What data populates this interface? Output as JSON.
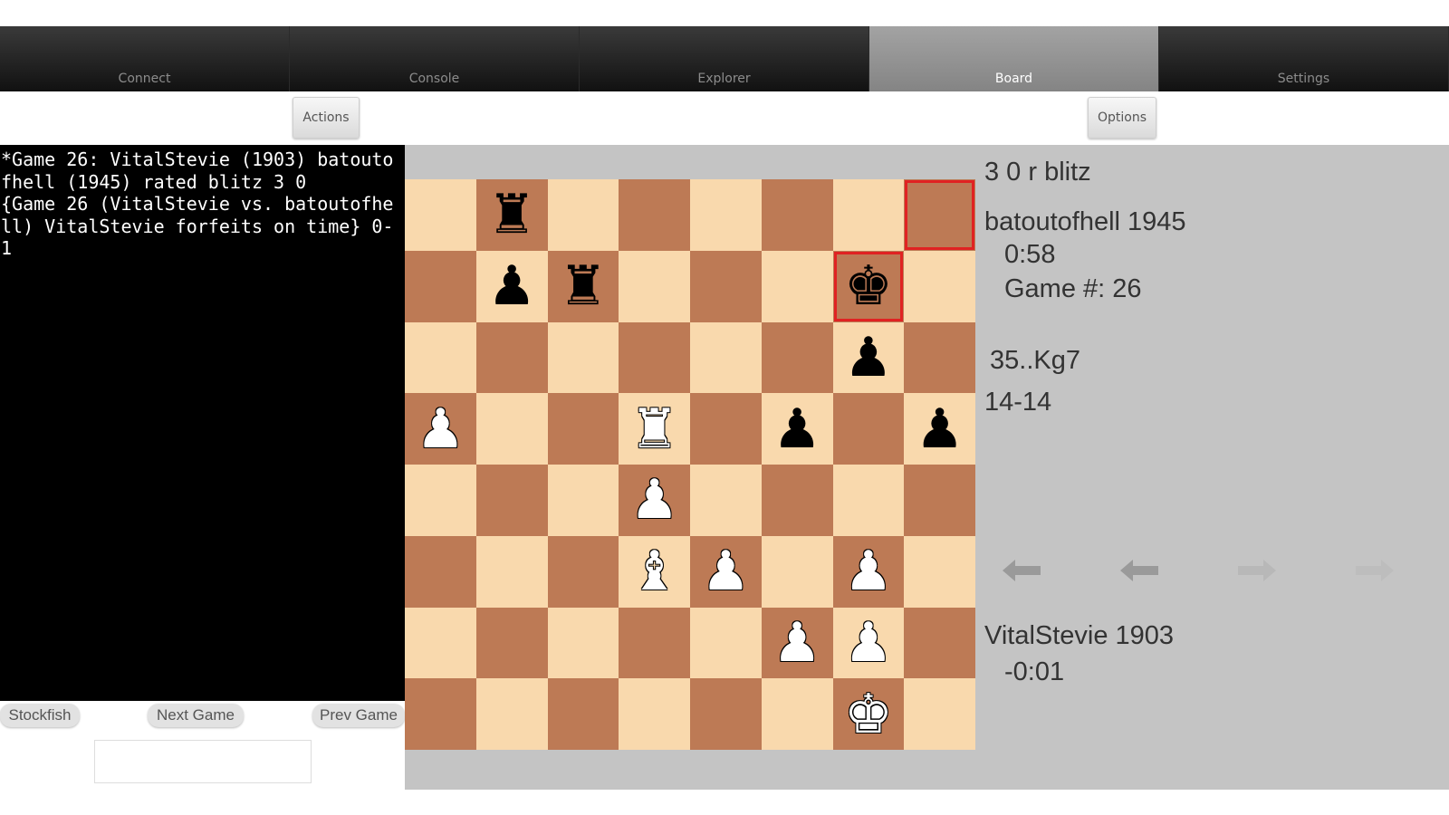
{
  "tabs": [
    {
      "label": "Connect",
      "active": false
    },
    {
      "label": "Console",
      "active": false
    },
    {
      "label": "Explorer",
      "active": false
    },
    {
      "label": "Board",
      "active": true
    },
    {
      "label": "Settings",
      "active": false
    }
  ],
  "toolbar": {
    "actions_label": "Actions",
    "options_label": "Options"
  },
  "console": {
    "text": "*Game 26: VitalStevie (1903) batoutofhell (1945) rated blitz 3 0\n{Game 26 (VitalStevie vs. batoutofhell) VitalStevie forfeits on time} 0-1"
  },
  "console_buttons": {
    "stockfish": "Stockfish",
    "next_game": "Next Game",
    "prev_game": "Prev Game"
  },
  "command_input": {
    "value": "",
    "placeholder": ""
  },
  "game": {
    "type": "3 0 r blitz",
    "top_player": "batoutofhell 1945",
    "top_clock": "0:58",
    "game_number": "Game #: 26",
    "last_move": "35..Kg7",
    "material": "14-14",
    "bottom_player": "VitalStevie 1903",
    "bottom_clock": "-0:01"
  },
  "board": {
    "orientation": "white",
    "light_color": "#f9d9ad",
    "dark_color": "#bd7a55",
    "highlight_color": "#e02222",
    "highlighted_squares": [
      "h8",
      "g7"
    ],
    "pieces": [
      {
        "square": "b8",
        "piece": "rook",
        "color": "black"
      },
      {
        "square": "b7",
        "piece": "pawn",
        "color": "black"
      },
      {
        "square": "c7",
        "piece": "rook",
        "color": "black"
      },
      {
        "square": "g7",
        "piece": "king",
        "color": "black"
      },
      {
        "square": "g6",
        "piece": "pawn",
        "color": "black"
      },
      {
        "square": "a5",
        "piece": "pawn",
        "color": "white"
      },
      {
        "square": "d5",
        "piece": "rook",
        "color": "white"
      },
      {
        "square": "f5",
        "piece": "pawn",
        "color": "black"
      },
      {
        "square": "h5",
        "piece": "pawn",
        "color": "black"
      },
      {
        "square": "d4",
        "piece": "pawn",
        "color": "white"
      },
      {
        "square": "d3",
        "piece": "bishop",
        "color": "white"
      },
      {
        "square": "e3",
        "piece": "pawn",
        "color": "white"
      },
      {
        "square": "g3",
        "piece": "pawn",
        "color": "white"
      },
      {
        "square": "f2",
        "piece": "pawn",
        "color": "white"
      },
      {
        "square": "g2",
        "piece": "pawn",
        "color": "white"
      },
      {
        "square": "g1",
        "piece": "king",
        "color": "white"
      }
    ]
  },
  "navigation": [
    {
      "name": "first-move-icon",
      "enabled": true
    },
    {
      "name": "previous-move-icon",
      "enabled": true
    },
    {
      "name": "next-move-icon",
      "enabled": false
    },
    {
      "name": "last-move-icon",
      "enabled": false
    }
  ]
}
